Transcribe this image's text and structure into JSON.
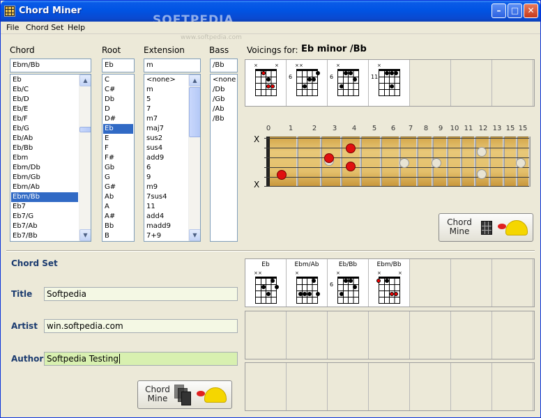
{
  "window": {
    "title": "Chord Miner",
    "minimize_icon": "minimize-icon",
    "maximize_icon": "maximize-icon",
    "close_icon": "close-icon"
  },
  "watermark": {
    "main": "SOFTPEDIA",
    "sub": "www.softpedia.com"
  },
  "menu": [
    "File",
    "Chord Set",
    "Help"
  ],
  "chord_section": {
    "labels": {
      "chord": "Chord",
      "root": "Root",
      "extension": "Extension",
      "bass": "Bass"
    },
    "chord_input": "Ebm/Bb",
    "root_input": "Eb",
    "extension_input": "m",
    "bass_input": "/Bb",
    "chord_list": [
      "Eb",
      "Eb/C",
      "Eb/D",
      "Eb/E",
      "Eb/F",
      "Eb/G",
      "Eb/Ab",
      "Eb/Bb",
      "Ebm",
      "Ebm/Db",
      "Ebm/Gb",
      "Ebm/Ab",
      "Ebm/Bb",
      "Eb7",
      "Eb7/G",
      "Eb7/Ab",
      "Eb7/Bb"
    ],
    "chord_selected": "Ebm/Bb",
    "root_list": [
      "C",
      "C#",
      "Db",
      "D",
      "D#",
      "Eb",
      "E",
      "F",
      "F#",
      "Gb",
      "G",
      "G#",
      "Ab",
      "A",
      "A#",
      "Bb",
      "B"
    ],
    "root_selected": "Eb",
    "extension_list": [
      "<none>",
      "m",
      "5",
      "7",
      "m7",
      "maj7",
      "sus2",
      "sus4",
      "add9",
      "6",
      "9",
      "m9",
      "7sus4",
      "11",
      "add4",
      "madd9",
      "7+9"
    ],
    "bass_list": [
      "<none>",
      "/Db",
      "/Gb",
      "/Ab",
      "/Bb"
    ]
  },
  "voicings": {
    "label": "Voicings for:",
    "chord_name": "Eb minor /Bb",
    "fret_labels": [
      "",
      "6",
      "6",
      "11"
    ]
  },
  "fretboard": {
    "fret_numbers": [
      "0",
      "1",
      "2",
      "3",
      "4",
      "5",
      "6",
      "7",
      "8",
      "9",
      "10",
      "11",
      "12",
      "13",
      "15",
      "15"
    ],
    "muted": [
      "X",
      "X"
    ]
  },
  "chord_mine_button": {
    "line1": "Chord",
    "line2": "Mine"
  },
  "chord_set": {
    "heading": "Chord Set",
    "title_label": "Title",
    "title_value": "Softpedia",
    "artist_label": "Artist",
    "artist_value": "win.softpedia.com",
    "author_label": "Author",
    "author_value": "Softpedia Testing",
    "chords": [
      "Eb",
      "Ebm/Ab",
      "Eb/Bb",
      "Ebm/Bb"
    ],
    "fret_labels": [
      "",
      "",
      "6",
      ""
    ]
  },
  "set_mine_button": {
    "line1": "Chord",
    "line2": "Mine"
  }
}
